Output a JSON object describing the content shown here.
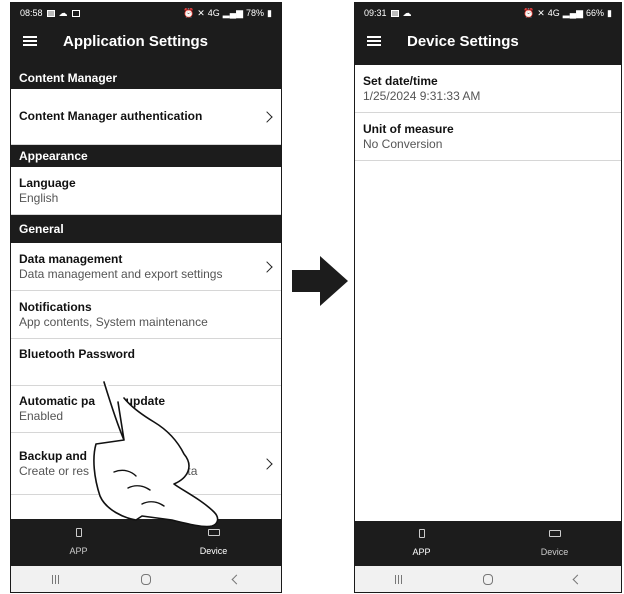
{
  "left": {
    "status": {
      "time": "08:58",
      "battery": "78%",
      "network": "4G"
    },
    "title": "Application Settings",
    "sections": [
      {
        "header": "Content Manager"
      },
      {
        "row": {
          "title": "Content Manager authentication",
          "subtitle": ""
        }
      },
      {
        "header": "Appearance"
      },
      {
        "row": {
          "title": "Language",
          "subtitle": "English"
        }
      },
      {
        "header": "General"
      },
      {
        "row": {
          "title": "Data management",
          "subtitle": "Data management and export settings"
        }
      },
      {
        "row": {
          "title": "Notifications",
          "subtitle": "App contents, System maintenance"
        }
      },
      {
        "row": {
          "title": "Bluetooth Password",
          "subtitle": ""
        }
      },
      {
        "row": {
          "title": "Automatic pa     et update",
          "subtitle": "Enabled"
        }
      },
      {
        "row": {
          "title": "Backup and",
          "subtitle": "Create or res              f app's data"
        }
      }
    ],
    "nav": {
      "app": "APP",
      "device": "Device"
    }
  },
  "right": {
    "status": {
      "time": "09:31",
      "battery": "66%",
      "network": "4G"
    },
    "title": "Device Settings",
    "rows": [
      {
        "title": "Set date/time",
        "subtitle": "1/25/2024 9:31:33 AM"
      },
      {
        "title": "Unit of measure",
        "subtitle": "No Conversion"
      }
    ],
    "nav": {
      "app": "APP",
      "device": "Device"
    }
  },
  "sysnav": {
    "recent": "recent-apps-icon",
    "home": "home-icon",
    "back": "back-icon"
  }
}
